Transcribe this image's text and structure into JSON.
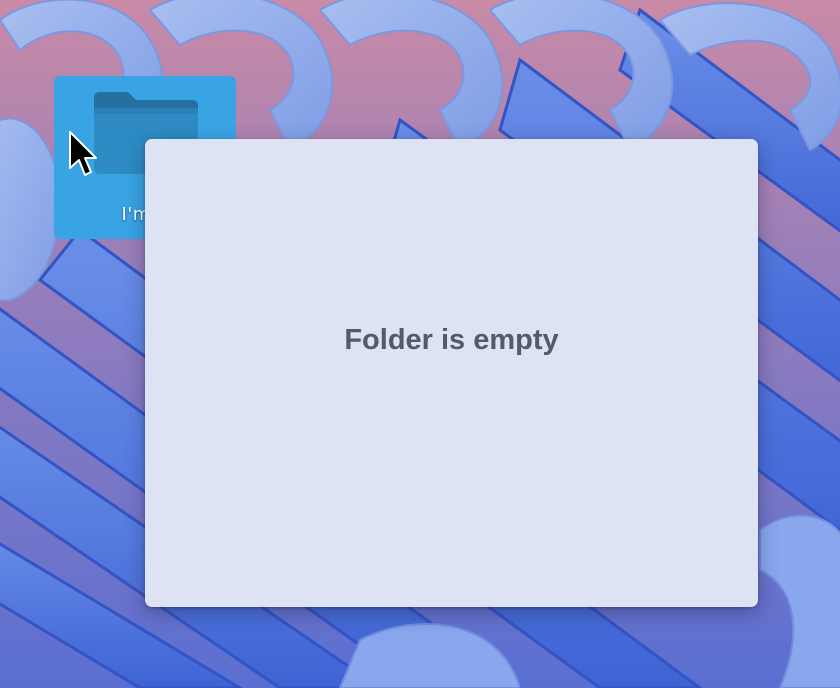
{
  "desktop": {
    "icon_label": "I'm e",
    "icon_name": "folder-icon",
    "colors": {
      "icon_highlight": "#39a4e4",
      "folder_body": "#2e8bc4",
      "folder_tab": "#24719f"
    }
  },
  "popup": {
    "message": "Folder is empty",
    "background": "#dde3f2"
  },
  "cursor": {
    "icon_name": "arrow-cursor-icon"
  }
}
